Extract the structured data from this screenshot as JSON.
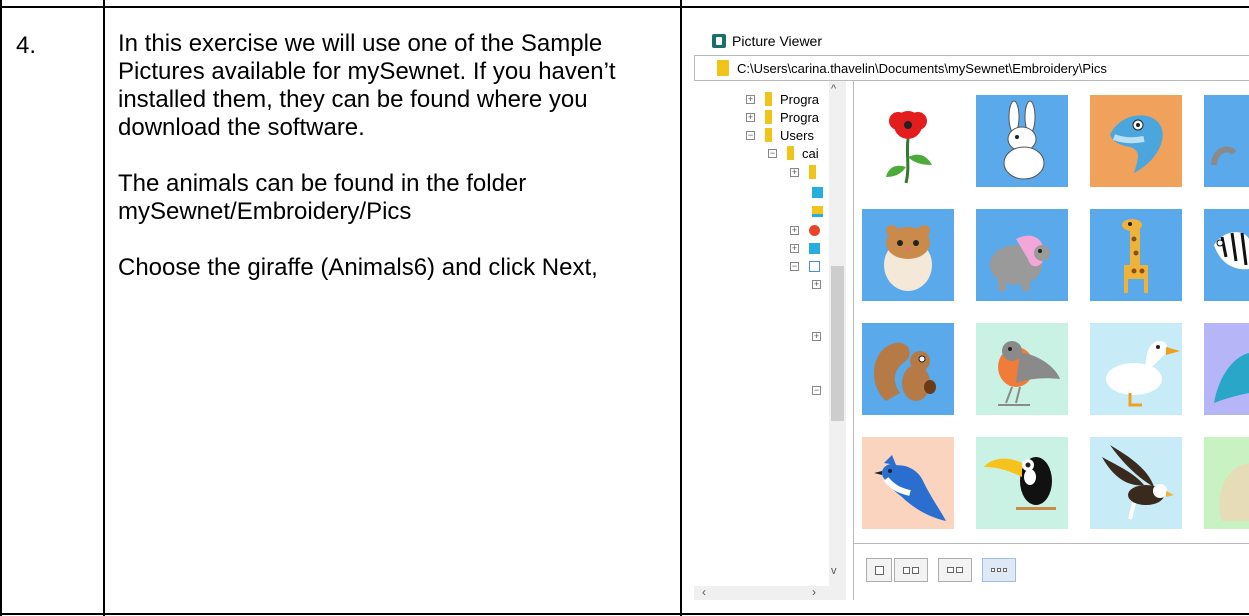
{
  "step": {
    "number": "4."
  },
  "instructions": [
    "In this exercise we will use one of the Sample Pictures available for mySewnet. If you haven’t installed them, they can be found where you download the software.",
    "The animals can be found in the folder mySewnet/Embroidery/Pics",
    "Choose the giraffe (Animals6) and click Next,"
  ],
  "viewer": {
    "title": "Picture Viewer",
    "path": "C:\\Users\\carina.thavelin\\Documents\\mySewnet\\Embroidery\\Pics",
    "tree": [
      {
        "label": "Progra",
        "expander": "+"
      },
      {
        "label": "Progra",
        "expander": "+"
      },
      {
        "label": "Users",
        "expander": "−"
      },
      {
        "label": "cai",
        "expander": "−"
      }
    ],
    "thumbnails": [
      {
        "name": "poppy",
        "bg": "#ffffff"
      },
      {
        "name": "rabbit",
        "bg": "#5aa9ea"
      },
      {
        "name": "dolphin",
        "bg": "#f0a25c"
      },
      {
        "name": "partial-blue",
        "bg": "#5aa9ea"
      },
      {
        "name": "hamster",
        "bg": "#5aa9ea"
      },
      {
        "name": "elephant",
        "bg": "#5aa9ea"
      },
      {
        "name": "giraffe",
        "bg": "#5aa9ea"
      },
      {
        "name": "zebra",
        "bg": "#5aa9ea"
      },
      {
        "name": "squirrel",
        "bg": "#5aa9ea"
      },
      {
        "name": "robin",
        "bg": "#c9f2e4"
      },
      {
        "name": "duck",
        "bg": "#c7ecf7"
      },
      {
        "name": "kingfisher",
        "bg": "#b5b5f7"
      },
      {
        "name": "blue-jay",
        "bg": "#fbd4bf"
      },
      {
        "name": "toucan",
        "bg": "#c9f2e4"
      },
      {
        "name": "eagle",
        "bg": "#c7ecf7"
      },
      {
        "name": "partial-green",
        "bg": "#c9f2c2"
      }
    ]
  }
}
